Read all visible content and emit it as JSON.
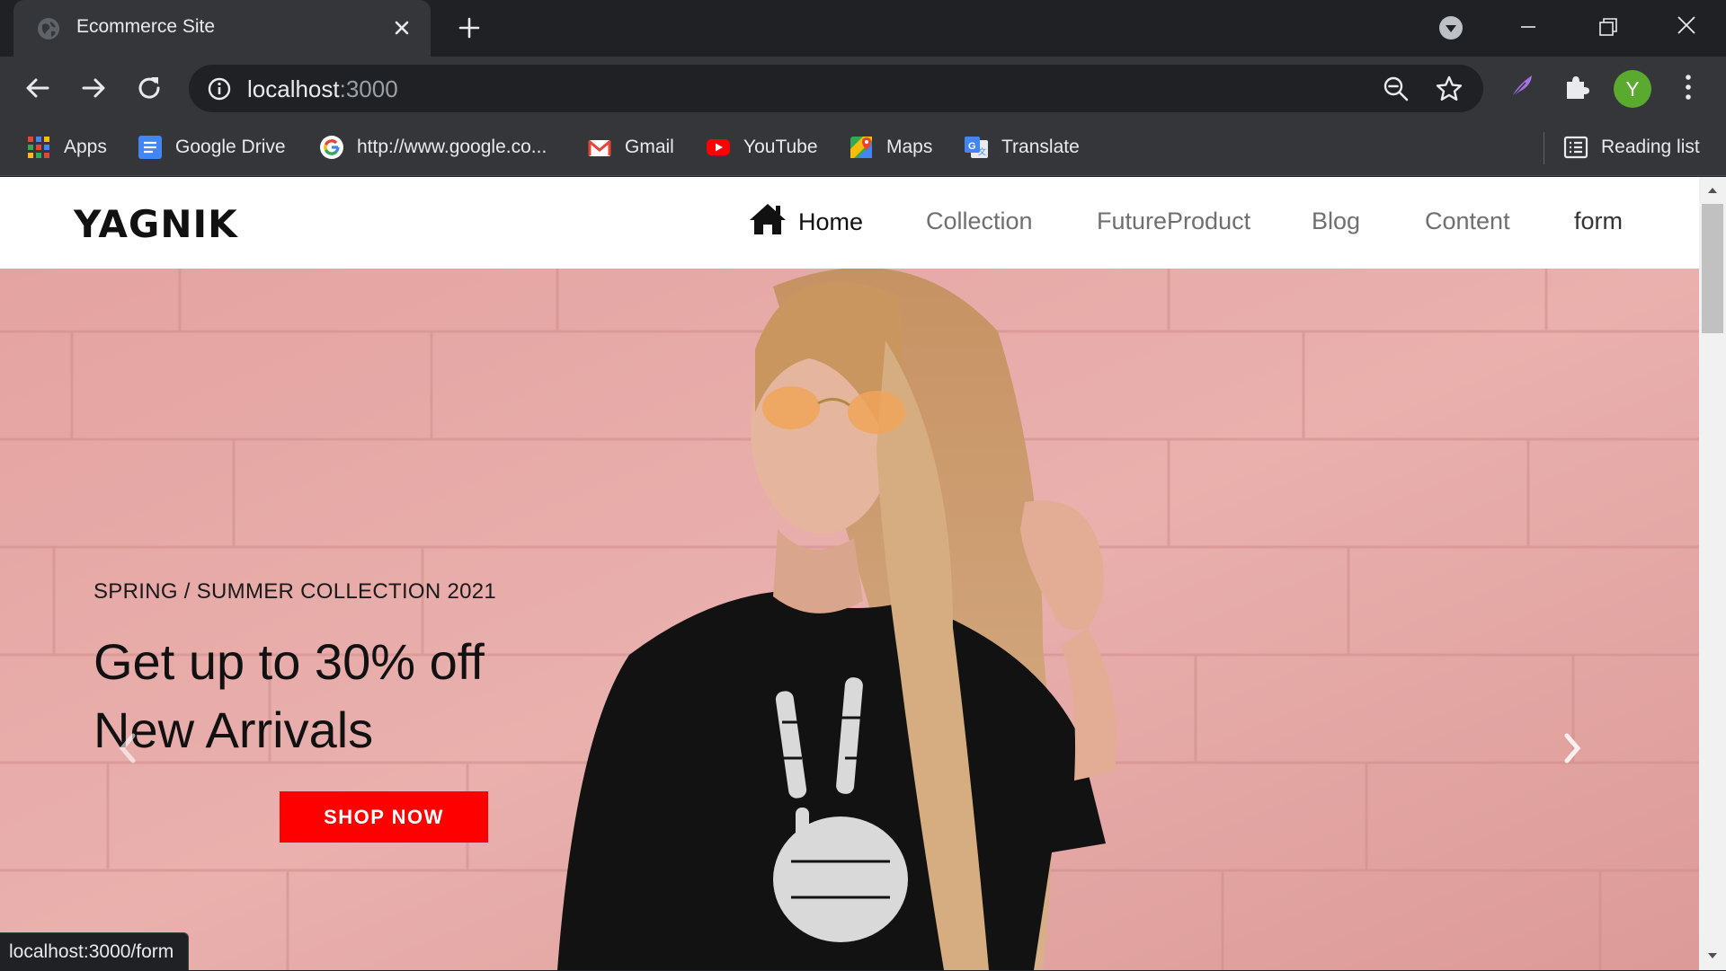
{
  "browser": {
    "tab_title": "Ecommerce Site",
    "url_host": "localhost",
    "url_port": ":3000",
    "avatar_letter": "Y",
    "status_url": "localhost:3000/form",
    "accent_avatar": "#5aaa30"
  },
  "bookmarks": [
    {
      "label": "Apps",
      "icon": "apps-grid-icon"
    },
    {
      "label": "Google Drive",
      "icon": "google-docs-icon"
    },
    {
      "label": "http://www.google.co...",
      "icon": "google-icon"
    },
    {
      "label": "Gmail",
      "icon": "gmail-icon"
    },
    {
      "label": "YouTube",
      "icon": "youtube-icon"
    },
    {
      "label": "Maps",
      "icon": "maps-icon"
    },
    {
      "label": "Translate",
      "icon": "translate-icon"
    }
  ],
  "reading_list": "Reading list",
  "site": {
    "logo": "YAGNIK",
    "nav": {
      "home": "Home",
      "collection": "Collection",
      "future_product": "FutureProduct",
      "blog": "Blog",
      "content": "Content",
      "form": "form"
    },
    "hero": {
      "eyebrow": "SPRING / SUMMER COLLECTION 2021",
      "headline_line1": "Get up to 30% off",
      "headline_line2": "New Arrivals",
      "cta": "SHOP NOW",
      "cta_color": "#fe0000",
      "background_color": "#e6a7a5"
    }
  }
}
